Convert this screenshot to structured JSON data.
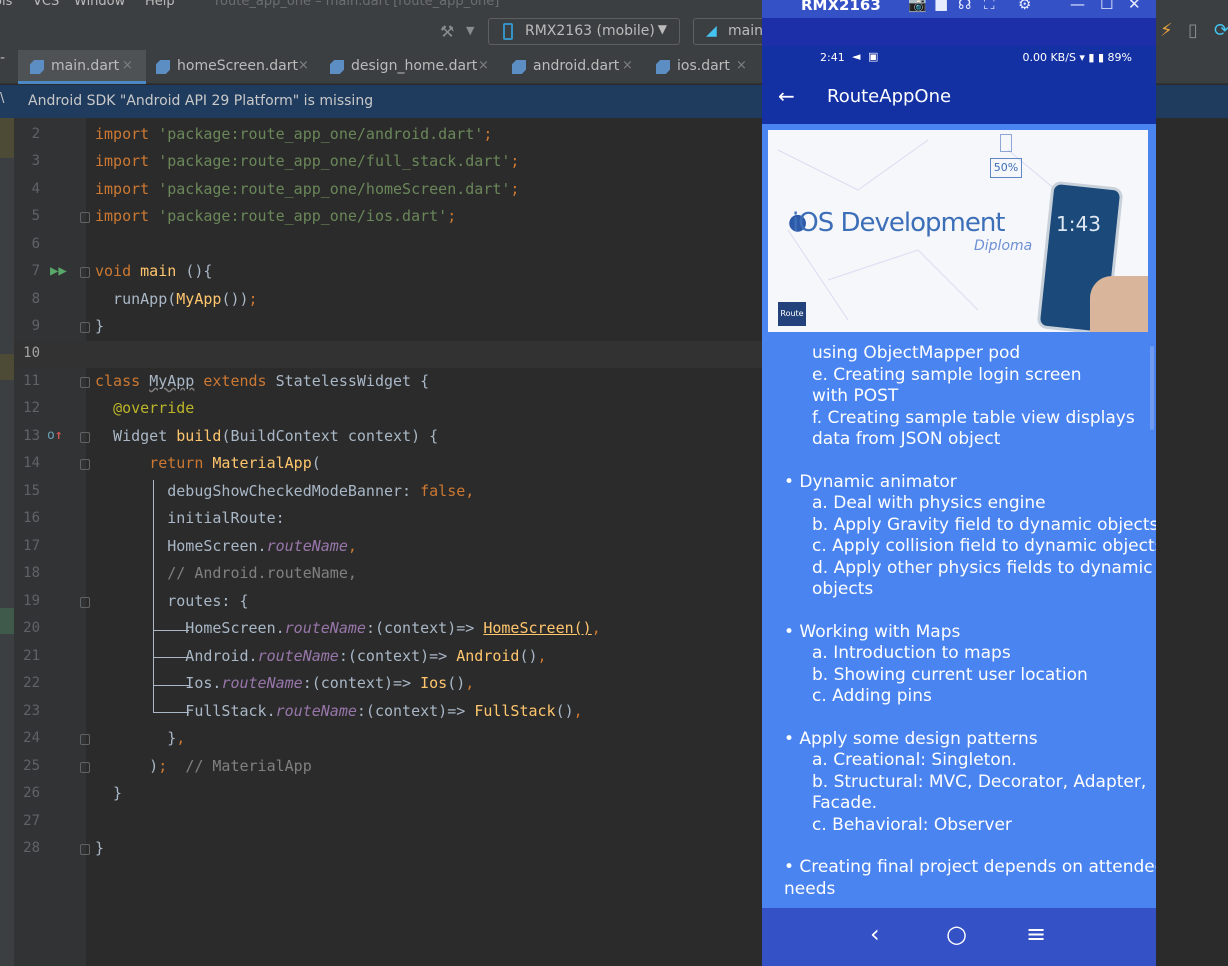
{
  "menu": {
    "items": [
      "ols",
      "VCS",
      "Window",
      "Help"
    ],
    "title": "route_app_one – main.dart [route_app_one]"
  },
  "toolbar": {
    "device": "RMX2163 (mobile)",
    "config": "main",
    "icons": [
      "hammer-icon",
      "lightning-icon",
      "sync-icon",
      "flutter-icon"
    ]
  },
  "tabs": [
    {
      "name": "main.dart",
      "active": true
    },
    {
      "name": "homeScreen.dart",
      "active": false
    },
    {
      "name": "design_home.dart",
      "active": false
    },
    {
      "name": "android.dart",
      "active": false
    },
    {
      "name": "ios.dart",
      "active": false
    }
  ],
  "banner": {
    "left": "\\",
    "message": "Android SDK \"Android API 29 Platform\" is missing"
  },
  "editor": {
    "line_numbers": [
      "2",
      "3",
      "4",
      "5",
      "6",
      "7",
      "8",
      "9",
      "10",
      "11",
      "12",
      "13",
      "14",
      "15",
      "16",
      "17",
      "18",
      "19",
      "20",
      "21",
      "22",
      "23",
      "24",
      "25",
      "26",
      "27",
      "28"
    ]
  },
  "emulator": {
    "device_name": "RMX2163",
    "status_time": "2:41",
    "status_right": "0.00 KB/S ▾ ▮ ▮ 89%",
    "app_title": "RouteAppOne",
    "banner": {
      "title": "iOS Development",
      "subtitle": "Diploma",
      "badge": "50%",
      "phone_time": "1:43",
      "logo": "Route"
    },
    "content_lines": [
      "using ObjectMapper pod",
      "e.  Creating sample login screen",
      "with POST",
      "f.  Creating sample table view displays",
      "data from JSON object",
      "• Dynamic animator",
      "a.  Deal with physics engine",
      "b.  Apply Gravity field to dynamic objects",
      "c.  Apply collision field to dynamic objects",
      "d.  Apply other physics fields to dynamic",
      "objects",
      "• Working with Maps",
      "a.  Introduction to maps",
      "b.  Showing current user location",
      "c.  Adding pins",
      "• Apply some design patterns",
      "a.  Creational: Singleton.",
      "b.  Structural: MVC, Decorator, Adapter,",
      "Facade.",
      "c.  Behavioral: Observer",
      "• Creating final project depends on attendees",
      "needs"
    ]
  }
}
